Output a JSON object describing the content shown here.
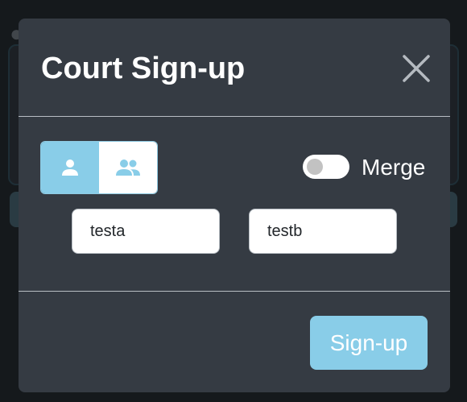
{
  "modal": {
    "title": "Court Sign-up"
  },
  "mode_toggle": {
    "single_icon": "person-icon",
    "double_icon": "people-icon",
    "selected": "single"
  },
  "merge": {
    "label": "Merge",
    "enabled": false
  },
  "inputs": {
    "player_a": "testa",
    "player_b": "testb"
  },
  "footer": {
    "signup_label": "Sign-up"
  },
  "colors": {
    "accent": "#89cde8",
    "modal_bg": "#353b43",
    "page_bg": "#1b1f23"
  }
}
